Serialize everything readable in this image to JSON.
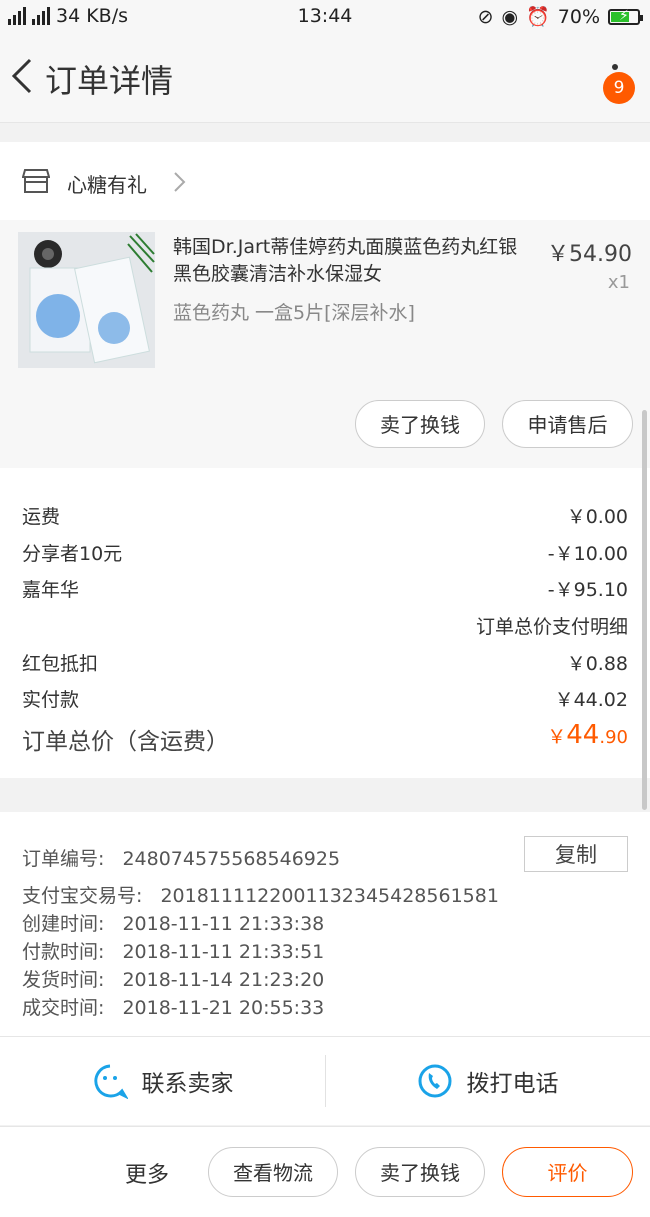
{
  "status_bar": {
    "network_speed": "34 KB/s",
    "time": "13:44",
    "battery": "70%",
    "battery_level": 0.7
  },
  "nav": {
    "title": "订单详情",
    "badge": "9"
  },
  "shop": {
    "name": "心糖有礼"
  },
  "item": {
    "title": "韩国Dr.Jart蒂佳婷药丸面膜蓝色药丸红银黑色胶囊清洁补水保湿女",
    "sku": "蓝色药丸 一盒5片[深层补水]",
    "price": "￥54.90",
    "qty": "x1",
    "btn_sell": "卖了换钱",
    "btn_after_sale": "申请售后"
  },
  "fees": {
    "rows": [
      {
        "label": "运费",
        "value": "￥0.00"
      },
      {
        "label": "分享者10元",
        "value": "-￥10.00"
      },
      {
        "label": "嘉年华",
        "value": "-￥95.10"
      },
      {
        "label": "红包抵扣",
        "value": "￥0.88"
      },
      {
        "label": "实付款",
        "value": "￥44.02"
      }
    ],
    "payment_detail": "订单总价支付明细",
    "total_label": "订单总价（含运费）",
    "total_currency": "￥",
    "total_int": "44",
    "total_dec": ".90"
  },
  "meta": {
    "order_no_label": "订单编号:",
    "order_no": "248074575568546925",
    "copy_label": "复制",
    "alipay_label": "支付宝交易号:",
    "alipay_no": "2018111122001132345428561581",
    "created_label": "创建时间:",
    "created": "2018-11-11 21:33:38",
    "paid_label": "付款时间:",
    "paid": "2018-11-11 21:33:51",
    "shipped_label": "发货时间:",
    "shipped": "2018-11-14 21:23:20",
    "closed_label": "成交时间:",
    "closed": "2018-11-21 20:55:33"
  },
  "contact": {
    "seller": "联系卖家",
    "phone": "拨打电话"
  },
  "bottom": {
    "more": "更多",
    "logistics": "查看物流",
    "sell": "卖了换钱",
    "review": "评价"
  },
  "colors": {
    "accent": "#ff5a00",
    "icon_blue": "#1aa3e8"
  }
}
